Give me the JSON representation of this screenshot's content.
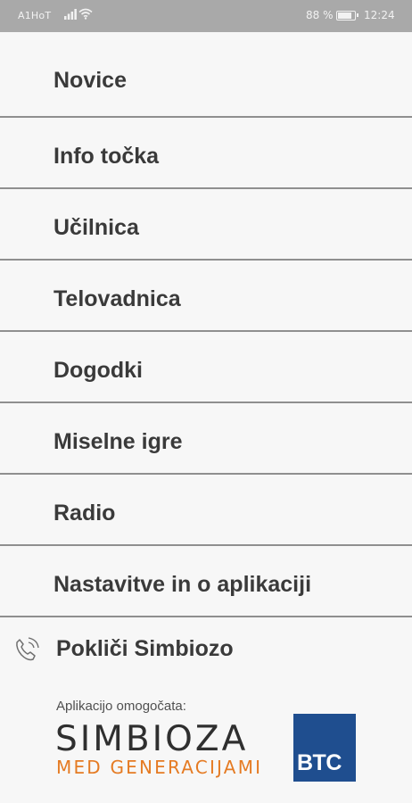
{
  "status_bar": {
    "carrier": "A1HoT",
    "battery_percent": "88 %",
    "time": "12:24",
    "icons": [
      "signal-icon",
      "wifi-icon",
      "battery-icon"
    ]
  },
  "menu": {
    "items": [
      {
        "label": "Novice"
      },
      {
        "label": "Info točka"
      },
      {
        "label": "Učilnica"
      },
      {
        "label": "Telovadnica"
      },
      {
        "label": "Dogodki"
      },
      {
        "label": "Miselne igre"
      },
      {
        "label": "Radio"
      },
      {
        "label": "Nastavitve in o aplikaciji"
      }
    ]
  },
  "call": {
    "label": "Pokliči Simbiozo",
    "icon": "phone-icon"
  },
  "footer": {
    "enabled_by": "Aplikacijo omogočata:",
    "logo_main": "SIMBIOZA",
    "logo_sub": "MED GENERACIJAMI",
    "partner": "BTC"
  },
  "colors": {
    "status_bar_bg": "#a9a9a9",
    "background": "#f7f7f7",
    "divider": "#8f8f8f",
    "logo_accent": "#e57b23",
    "btc_blue": "#1f4e8f"
  }
}
